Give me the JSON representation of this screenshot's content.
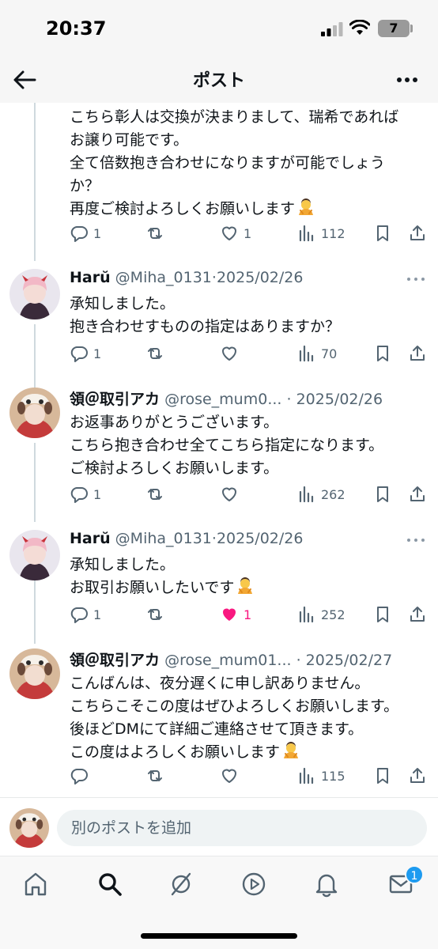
{
  "status_bar": {
    "time": "20:37",
    "battery_level": "7",
    "icons": [
      "cellular-signal-icon",
      "wifi-icon",
      "battery-icon"
    ]
  },
  "header": {
    "title": "ポスト",
    "back_icon": "arrow-left-icon",
    "more_icon": "more-horizontal-icon"
  },
  "thread": [
    {
      "partial": true,
      "body": "こちら彰人は交換が決まりまして、瑞希であれば\nお譲り可能です。\n全て倍数抱き合わせになりますが可能でしょう\nか？\n再度ご検討よろしくお願いします",
      "emoji": "bowing-person",
      "counts": {
        "replies": "1",
        "retweets": "",
        "likes": "1",
        "views": "112"
      },
      "liked": false
    },
    {
      "name": "Harŭ",
      "handle": "@Miha_0131",
      "date": "2025/02/26",
      "body": "承知しました。\n抱き合わせすものの指定はありますか？",
      "counts": {
        "replies": "1",
        "retweets": "",
        "likes": "",
        "views": "70"
      },
      "liked": false
    },
    {
      "name": "領＠取引アカ",
      "handle": "@rose_mum0...",
      "date": "2025/02/26",
      "body": "お返事ありがとうございます。\nこちら抱き合わせ全てこちら指定になります。\nご検討よろしくお願いします。",
      "counts": {
        "replies": "1",
        "retweets": "",
        "likes": "",
        "views": "262"
      },
      "liked": false
    },
    {
      "name": "Harŭ",
      "handle": "@Miha_0131",
      "date": "2025/02/26",
      "body": "承知しました。\nお取引お願いしたいです",
      "emoji": "bowing-person",
      "counts": {
        "replies": "1",
        "retweets": "",
        "likes": "1",
        "views": "252"
      },
      "liked": true
    },
    {
      "name": "領＠取引アカ",
      "handle": "@rose_mum01...",
      "date": "2025/02/27",
      "body": "こんばんは、夜分遅くに申し訳ありません。\nこちらこそこの度はぜひよろしくお願いします。\n後ほどDMにて詳細ご連絡させて頂きます。\nこの度はよろしくお願いします",
      "emoji": "bowing-person",
      "counts": {
        "replies": "",
        "retweets": "",
        "likes": "",
        "views": "115"
      },
      "liked": false
    }
  ],
  "composer": {
    "placeholder": "別のポストを追加"
  },
  "tabbar": {
    "tabs": [
      "home-icon",
      "search-icon",
      "grok-icon",
      "video-icon",
      "notifications-icon",
      "messages-icon"
    ],
    "messages_badge": "1"
  },
  "colors": {
    "accent": "#1d9bf0",
    "like": "#f91880",
    "text": "#0f1419",
    "muted": "#536471"
  }
}
